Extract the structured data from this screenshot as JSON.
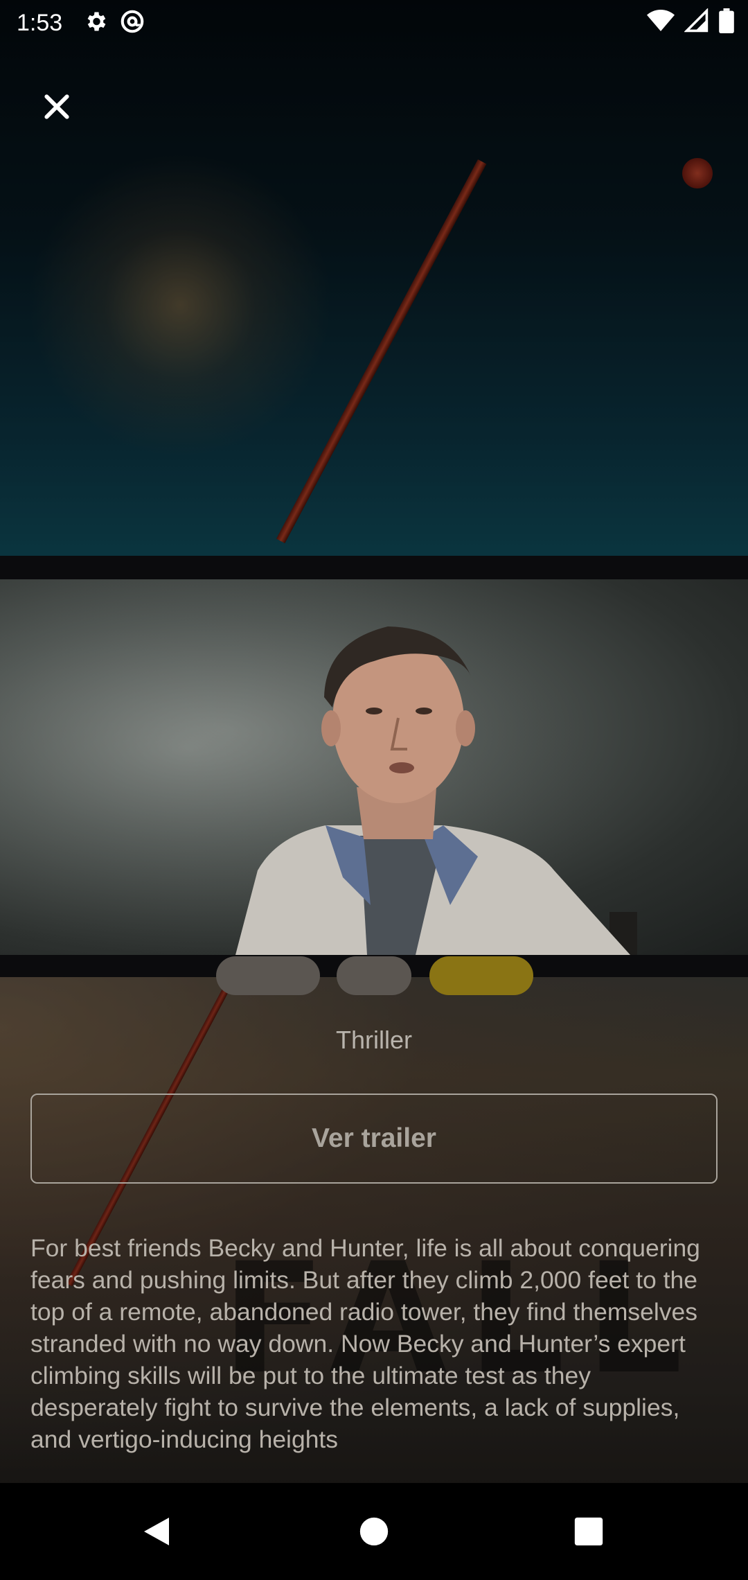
{
  "status_bar": {
    "time": "1:53",
    "left_icons": [
      "settings-icon",
      "at-sign-icon"
    ],
    "right_icons": [
      "wifi-icon",
      "signal-icon",
      "battery-icon"
    ]
  },
  "close_button": {
    "icon": "close-icon"
  },
  "video": {
    "content": "trailer-video-frame"
  },
  "movie": {
    "genre": "Thriller",
    "trailer_button_label": "Ver trailer",
    "synopsis": "For best friends Becky and Hunter, life is all about conquering fears and pushing limits. But after they climb 2,000 feet to the top of a remote, abandoned radio tower, they find themselves stranded with no way down. Now Becky and Hunter’s expert climbing skills will be put to the ultimate test as they desperately fight to survive the elements, a lack of supplies, and vertigo-inducing heights"
  },
  "nav_bar": {
    "back_icon": "back-triangle-icon",
    "home_icon": "home-circle-icon",
    "recents_icon": "recents-square-icon"
  },
  "colors": {
    "accent": "#8a7414",
    "text_muted": "#b8b2aa"
  }
}
